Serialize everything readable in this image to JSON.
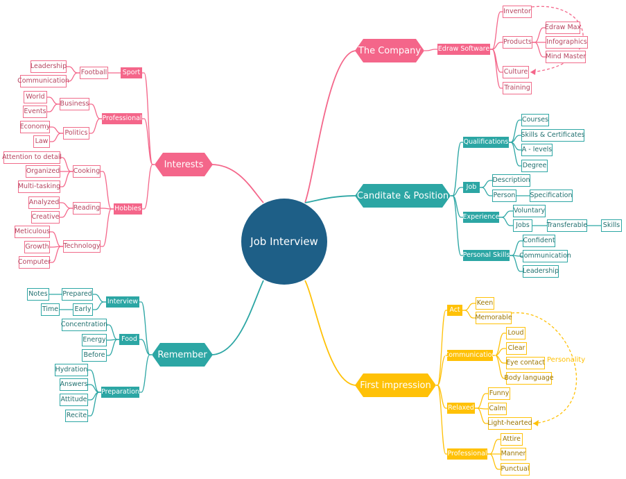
{
  "title": "Job Interview",
  "colors": {
    "root": "#1e5f87",
    "pink": "#f4668a",
    "teal": "#2ca6a4",
    "gold": "#ffc107"
  },
  "branches": {
    "company": {
      "label": "The Company",
      "color": "pink",
      "child": "Edraw Software",
      "items": [
        "Inventor",
        "Products",
        "Culture",
        "Training"
      ],
      "products": [
        "Edraw Max",
        "Infographics",
        "Mind Master"
      ]
    },
    "candidate": {
      "label": "Canditate & Position",
      "color": "teal",
      "qualifications": {
        "label": "Qualifications",
        "items": [
          "Courses",
          "Skills & Certificates",
          "A - levels",
          "Degree"
        ]
      },
      "job": {
        "label": "Job",
        "items": [
          "Description",
          "Person"
        ],
        "person_child": "Specification"
      },
      "experience": {
        "label": "Experience",
        "items": [
          "Voluntary",
          "Jobs"
        ],
        "jobs_child": "Transferable",
        "transferable_child": "Skills"
      },
      "personal_skills": {
        "label": "Personal Skills",
        "items": [
          "Confident",
          "Communication",
          "Leadership"
        ]
      }
    },
    "impression": {
      "label": "First impression",
      "color": "gold",
      "act": {
        "label": "Act",
        "items": [
          "Keen",
          "Memorable"
        ]
      },
      "communication": {
        "label": "Communication",
        "items": [
          "Loud",
          "Clear",
          "Eye contact",
          "Body language"
        ]
      },
      "relaxed": {
        "label": "Relaxed",
        "items": [
          "Funny",
          "Calm",
          "Light-hearted"
        ]
      },
      "professional": {
        "label": "Professional",
        "items": [
          "Attire",
          "Manner",
          "Punctual"
        ]
      },
      "relation_label": "Personality"
    },
    "interests": {
      "label": "Interests",
      "color": "pink",
      "sport": {
        "label": "Sport",
        "football": "Football",
        "items": [
          "Leadership",
          "Communication"
        ]
      },
      "professional": {
        "label": "Professional",
        "business": {
          "label": "Business",
          "items": [
            "World",
            "Events"
          ]
        },
        "politics": {
          "label": "Politics",
          "items": [
            "Economy",
            "Law"
          ]
        }
      },
      "hobbies": {
        "label": "Hobbies",
        "cooking": {
          "label": "Cooking",
          "items": [
            "Attention to detail",
            "Organized",
            "Multi-tasking"
          ]
        },
        "reading": {
          "label": "Reading",
          "items": [
            "Analyzed",
            "Creative"
          ]
        },
        "technology": {
          "label": "Technology",
          "items": [
            "Meticulous",
            "Growth",
            "Computer"
          ]
        }
      }
    },
    "remember": {
      "label": "Remember",
      "color": "teal",
      "interview": {
        "label": "Interview",
        "prepared": "Prepared",
        "prepared_child": "Notes",
        "early": "Early",
        "early_child": "Time"
      },
      "food": {
        "label": "Food",
        "items": [
          "Concentration",
          "Energy",
          "Before"
        ]
      },
      "preparation": {
        "label": "Preparation",
        "items": [
          "Hydration",
          "Answers",
          "Attitude",
          "Recite"
        ]
      }
    }
  }
}
